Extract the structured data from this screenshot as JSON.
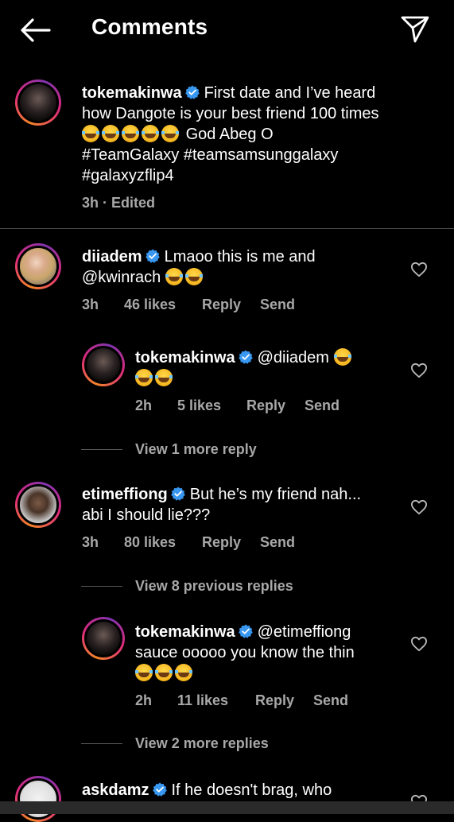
{
  "header": {
    "title": "Comments",
    "back_icon": "arrow-left-icon",
    "share_icon": "paper-plane-icon"
  },
  "colors": {
    "verified": "#3897f0",
    "meta": "#a8a8a8",
    "background": "#000000"
  },
  "caption": {
    "username": "tokemakinwa",
    "text_line1": "First date and I’ve heard",
    "text_line2": "how Dangote is your best friend 100 times",
    "text_line3_suffix": "God Abeg O",
    "text_line4": "#TeamGalaxy #teamsamsunggalaxy",
    "text_line5": "#galaxyzflip4",
    "meta": "3h · Edited"
  },
  "comments": [
    {
      "username": "diiadem",
      "text_line1": "Lmaoo this is me and",
      "text_line2": "@kwinrach",
      "time": "3h",
      "likes": "46 likes",
      "reply": "Reply",
      "send": "Send"
    },
    {
      "username": "tokemakinwa",
      "text_line1": "@diiadem",
      "time": "2h",
      "likes": "5 likes",
      "reply": "Reply",
      "send": "Send"
    },
    {
      "view_replies": "View 1 more reply"
    },
    {
      "username": "etimeffiong",
      "text_line1": "But he’s my friend nah...",
      "text_line2": "abi I should lie???",
      "time": "3h",
      "likes": "80 likes",
      "reply": "Reply",
      "send": "Send"
    },
    {
      "view_replies": "View 8 previous replies"
    },
    {
      "username": "tokemakinwa",
      "text_line1": "@etimeffiong",
      "text_line2": "sauce ooooo you know the thin",
      "time": "2h",
      "likes": "11 likes",
      "reply": "Reply",
      "send": "Send"
    },
    {
      "view_replies": "View 2 more replies"
    },
    {
      "username": "askdamz",
      "text_line1": "If he doesn't brag, who"
    }
  ]
}
